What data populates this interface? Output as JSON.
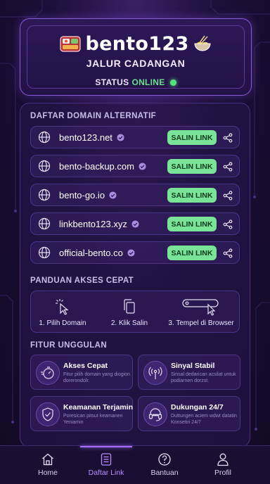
{
  "header": {
    "brand": "bento123",
    "subtitle": "JALUR CADANGAN",
    "status_label": "STATUS",
    "status_value": "ONLINE",
    "status_color": "#67e08b"
  },
  "domains": {
    "title": "DAFTAR DOMAIN ALTERNATIF",
    "copy_label": "SALIN LINK",
    "items": [
      {
        "name": "bento123.net"
      },
      {
        "name": "bento-backup.com"
      },
      {
        "name": "bento-go.io"
      },
      {
        "name": "linkbento123.xyz"
      },
      {
        "name": "official-bento.co"
      }
    ]
  },
  "guide": {
    "title": "PANDUAN AKSES CEPAT",
    "steps": [
      {
        "label": "1. Pilih Domain",
        "icon": "cursor-click-icon"
      },
      {
        "label": "2. Klik Salin",
        "icon": "copy-icon"
      },
      {
        "label": "3. Tempel di Browser",
        "icon": "address-bar-icon"
      }
    ]
  },
  "features": {
    "title": "FITUR UNGGULAN",
    "items": [
      {
        "title": "Akses Cepat",
        "desc": "Fitur pilih domain yang diogion dorerondolr.",
        "icon": "stopwatch-icon"
      },
      {
        "title": "Sinyal Stabil",
        "desc": "Sinsal dedarican acsilat untuk podiarnen dorzst.",
        "icon": "signal-tower-icon"
      },
      {
        "title": "Keamanan Terjamin",
        "desc": "Poresican pitsut keamanen Yeniamin",
        "icon": "shield-check-icon"
      },
      {
        "title": "Dukungan 24/7",
        "desc": "Duttungen aciem wdwt datatin Konsetiri 24/7",
        "icon": "headset-icon"
      }
    ]
  },
  "nav": {
    "items": [
      {
        "label": "Home",
        "icon": "home-icon"
      },
      {
        "label": "Daftar Link",
        "icon": "list-icon"
      },
      {
        "label": "Bantuan",
        "icon": "help-icon"
      },
      {
        "label": "Profil",
        "icon": "user-icon"
      }
    ],
    "active_index": 1
  },
  "colors": {
    "accent": "#a46cff",
    "copy_button": "#79e497",
    "background": "#1c0f38"
  }
}
